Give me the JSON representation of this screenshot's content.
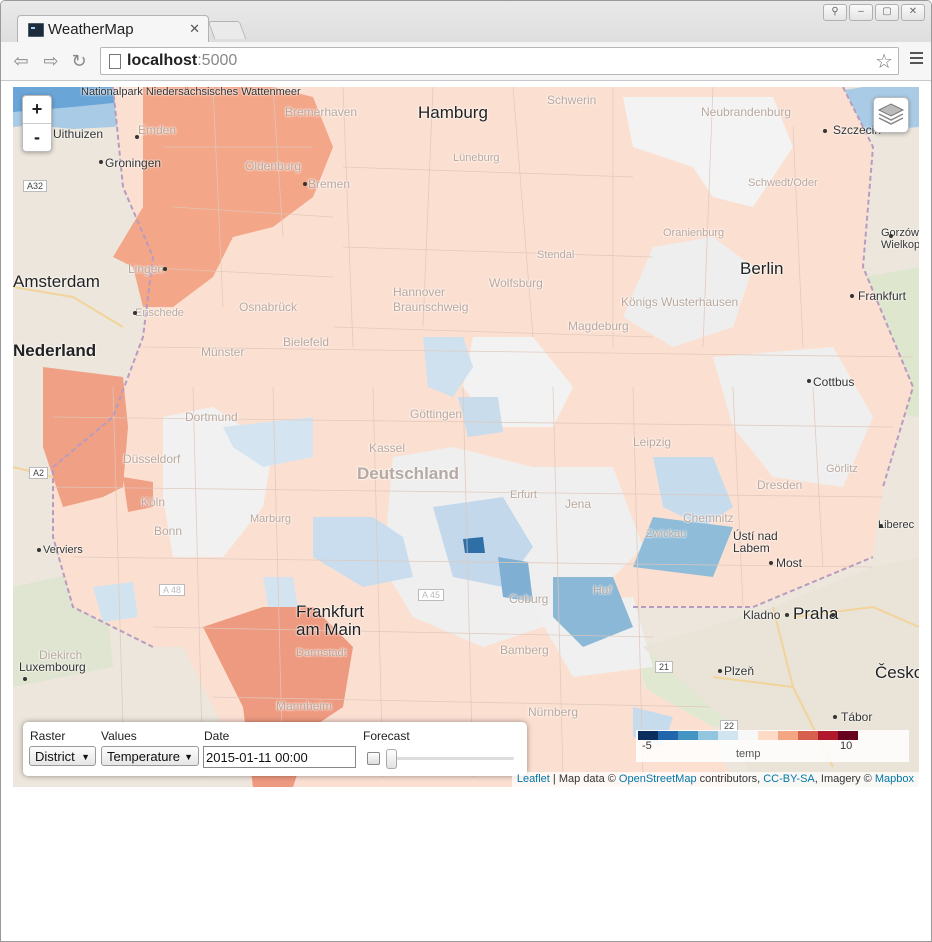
{
  "browser": {
    "tab_title": "WeatherMap",
    "url_host": "localhost",
    "url_port": ":5000"
  },
  "map": {
    "zoom_in": "+",
    "zoom_out": "-",
    "places": [
      "Nationalpark Niedersächsisches Wattenmeer",
      "Bremerhaven",
      "Hamburg",
      "Schwerin",
      "Neubrandenburg",
      "Szczecin",
      "Uithuizen",
      "Emden",
      "Groningen",
      "Oldenburg",
      "Bremen",
      "Lüneburg",
      "Schwedt/Oder",
      "Gorzów Wielkopolski",
      "A32",
      "Oranienburg",
      "Lingen",
      "Stendal",
      "Hannover",
      "Wolfsburg",
      "Berlin",
      "Frankfurt",
      "Enschede",
      "Osnabrück",
      "Braunschweig",
      "Königs Wusterhausen",
      "Magdeburg",
      "Münster",
      "Bielefeld",
      "Cottbus",
      "Dortmund",
      "Göttingen",
      "Kassel",
      "Leipzig",
      "Deutschland",
      "Düsseldorf",
      "Dresden",
      "Görlitz",
      "A2",
      "Köln",
      "Erfurt",
      "Jena",
      "Bonn",
      "Marburg",
      "Chemnitz",
      "Liberec",
      "Zwickau",
      "Ústí nad Labem",
      "Verviers",
      "A 45",
      "Most",
      "A 48",
      "Coburg",
      "Hof",
      "Kladno",
      "Praha",
      "Frankfurt am Main",
      "Bamberg",
      "Darmstadt",
      "Diekirch",
      "Luxembourg",
      "21",
      "Plzeň",
      "Česko",
      "Mannheim",
      "Nürnberg",
      "22",
      "Tábor",
      "Amsterdam",
      "Nederland"
    ]
  },
  "controls": {
    "raster_label": "Raster",
    "raster_value": "District",
    "values_label": "Values",
    "values_value": "Temperature",
    "date_label": "Date",
    "date_value": "2015-01-11 00:00",
    "forecast_label": "Forecast"
  },
  "legend": {
    "min": "-5",
    "max": "10",
    "title": "temp",
    "colors": [
      "#0b2e5c",
      "#2166ac",
      "#4393c3",
      "#92c5de",
      "#d1e5f0",
      "#f7f7f7",
      "#fddbc7",
      "#f4a582",
      "#d6604d",
      "#b2182b",
      "#67001f"
    ]
  },
  "attribution": {
    "leaflet": "Leaflet",
    "sep1": " | Map data © ",
    "osm": "OpenStreetMap",
    "contributors": " contributors, ",
    "license": "CC-BY-SA",
    "imagery": ", Imagery © ",
    "mapbox": "Mapbox"
  }
}
